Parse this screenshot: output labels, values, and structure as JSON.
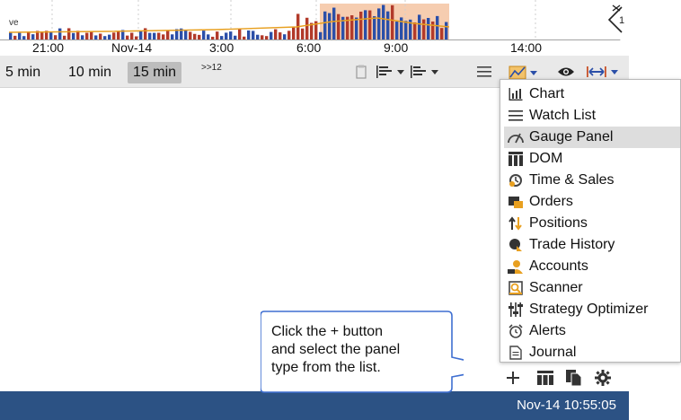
{
  "chart": {
    "corner_text": "ve",
    "time_ticks": [
      "21:00",
      "Nov-14",
      "3:00",
      "6:00",
      "9:00",
      "14:00"
    ]
  },
  "toolbar": {
    "intervals": [
      "5 min",
      "10 min",
      "15 min"
    ],
    "active_interval": "15 min",
    "more_label": ">>12"
  },
  "menu": {
    "items": [
      {
        "label": "Chart",
        "icon": "bar-chart-icon"
      },
      {
        "label": "Watch List",
        "icon": "list-lines-icon"
      },
      {
        "label": "Gauge Panel",
        "icon": "gauge-icon"
      },
      {
        "label": "DOM",
        "icon": "dom-columns-icon"
      },
      {
        "label": "Time & Sales",
        "icon": "time-sales-clock-icon"
      },
      {
        "label": "Orders",
        "icon": "orders-icon"
      },
      {
        "label": "Positions",
        "icon": "positions-arrows-icon"
      },
      {
        "label": "Trade History",
        "icon": "trade-history-icon"
      },
      {
        "label": "Accounts",
        "icon": "accounts-user-icon"
      },
      {
        "label": "Scanner",
        "icon": "scanner-icon"
      },
      {
        "label": "Strategy Optimizer",
        "icon": "optimizer-sliders-icon"
      },
      {
        "label": "Alerts",
        "icon": "alarm-clock-icon"
      },
      {
        "label": "Journal",
        "icon": "journal-icon"
      }
    ],
    "highlighted": "Gauge Panel"
  },
  "callout": {
    "lines": [
      "Click the + button",
      "and select the panel",
      "type from the list."
    ]
  },
  "status": {
    "datetime": "Nov-14 10:55:05"
  },
  "colors": {
    "status_bar": "#2c5284",
    "volume_up": "#2b4fa8",
    "volume_down": "#b23a2a",
    "highlight_band": "#f6cdb0",
    "accent_orange": "#e8a020"
  }
}
